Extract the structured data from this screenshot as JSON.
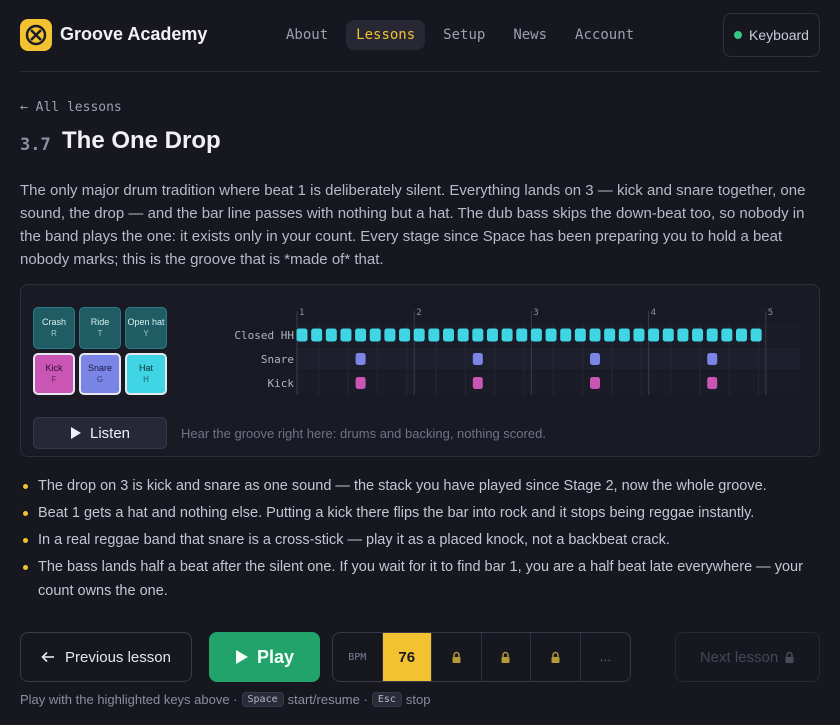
{
  "app": {
    "brand": "Groove Academy",
    "nav": [
      "About",
      "Lessons",
      "Setup",
      "News",
      "Account"
    ],
    "active_nav": "Lessons",
    "keyboard_label": "Keyboard",
    "keyboard_status_color": "#35c884",
    "accent": "#f2c231"
  },
  "lesson": {
    "breadcrumb": "← All lessons",
    "number": "3.7",
    "title": "The One Drop",
    "intro": "The only major drum tradition where beat 1 is deliberately silent. Everything lands on 3 — kick and snare together, one sound, the drop — and the bar line passes with nothing but a hat. The dub bass skips the down-beat too, so nobody in the band plays the one: it exists only in your count. Every stage since Space has been preparing you to hold a beat nobody marks; this is the groove that is *made of* that."
  },
  "pads": {
    "crash": {
      "label": "Crash",
      "key": "R"
    },
    "ride": {
      "label": "Ride",
      "key": "T"
    },
    "open_hat": {
      "label": "Open hat",
      "key": "Y"
    },
    "kick": {
      "label": "Kick",
      "key": "F"
    },
    "snare": {
      "label": "Snare",
      "key": "G"
    },
    "hat": {
      "label": "Hat",
      "key": "H"
    }
  },
  "groove": {
    "beat_numbers": [
      "1",
      "2",
      "3",
      "4",
      "5"
    ],
    "rows": [
      {
        "name": "Closed HH",
        "color": "#3fd5e4",
        "hits": [
          0,
          1,
          2,
          3,
          4,
          5,
          6,
          7,
          8,
          9,
          10,
          11,
          12,
          13,
          14,
          15,
          16,
          17,
          18,
          19,
          20,
          21,
          22,
          23,
          24,
          25,
          26,
          27,
          28,
          29,
          30,
          31
        ]
      },
      {
        "name": "Snare",
        "color": "#7b85e6",
        "hits": [
          4,
          12,
          20,
          28
        ]
      },
      {
        "name": "Kick",
        "color": "#c955b5",
        "hits": [
          4,
          12,
          20,
          28
        ]
      }
    ],
    "steps": 32,
    "listen_label": "Listen",
    "listen_note": "Hear the groove right here: drums and backing, nothing scored."
  },
  "bullets": [
    "The drop on 3 is kick and snare as one sound — the stack you have played since Stage 2, now the whole groove.",
    "Beat 1 gets a hat and nothing else. Putting a kick there flips the bar into rock and it stops being reggae instantly.",
    "In a real reggae band that snare is a cross-stick — play it as a placed knock, not a backbeat crack.",
    "The bass lands half a beat after the silent one. If you wait for it to find bar 1, you are a half beat late everywhere — your count owns the one."
  ],
  "controls": {
    "prev": "Previous lesson",
    "play": "Play",
    "bpm_label": "BPM",
    "bpm_value": "76",
    "more": "…",
    "next": "Next lesson",
    "play_color": "#22a36c"
  },
  "hint": {
    "prefix": "Play with the highlighted keys above ·",
    "key1": "Space",
    "text1": "start/resume ·",
    "key2": "Esc",
    "text2": "stop"
  }
}
